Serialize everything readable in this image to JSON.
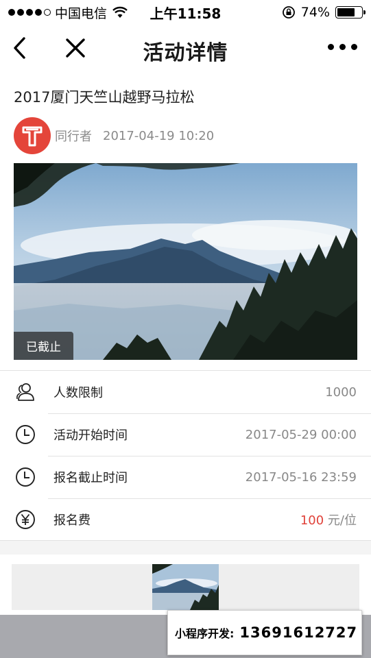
{
  "status_bar": {
    "carrier": "中国电信",
    "time": "上午11:58",
    "battery": "74%",
    "battery_level": 0.74
  },
  "nav": {
    "title": "活动详情"
  },
  "article": {
    "title": "2017厦门天竺山越野马拉松",
    "author": "同行者",
    "post_time": "2017-04-19 10:20",
    "cover_badge": "已截止"
  },
  "info": {
    "participants_label": "人数限制",
    "participants_value": "1000",
    "start_label": "活动开始时间",
    "start_value": "2017-05-29 00:00",
    "deadline_label": "报名截止时间",
    "deadline_value": "2017-05-16 23:59",
    "fee_label": "报名费",
    "fee_amount": "100",
    "fee_unit": " 元/位"
  },
  "dev_banner": {
    "label": "小程序开发:",
    "phone": "13691612727"
  },
  "icons": {
    "back": "chevron-left-icon",
    "close": "close-icon",
    "more": "more-dots-icon",
    "people": "people-icon",
    "clock": "clock-icon",
    "yen": "yen-icon"
  },
  "colors": {
    "avatar": "#e4453a",
    "fee": "#e0423a"
  }
}
